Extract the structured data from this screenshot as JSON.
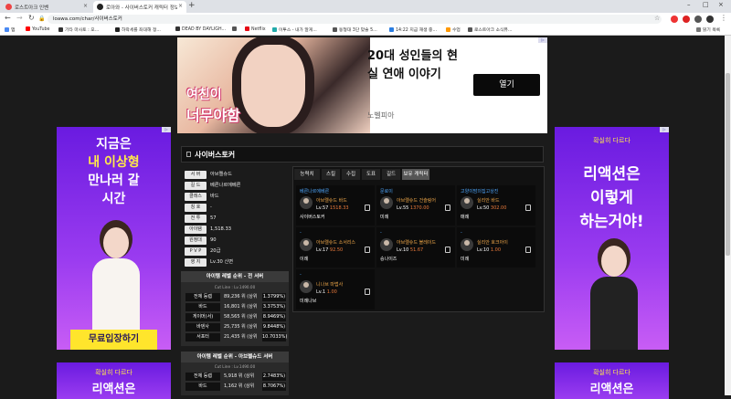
{
  "browser": {
    "tabs": [
      {
        "title": "로스트아크 인벤",
        "active": false
      },
      {
        "title": "로아와 - 사이버스토커 캐릭터 정보",
        "active": true
      }
    ],
    "url": "loawa.com/char/사이버스토커",
    "bookmarks": [
      "앱",
      "YouTube",
      "기타 마사토 : 오...",
      "하락세를 좌대해 정...",
      "DEAD BY DAYLIGH...",
      "",
      "Netflix",
      "이투스 - 내가 알게...",
      "동형대 3단 맞술 5...",
      "14:22 지금 재생 중...",
      "수업",
      "로스트아크 소식뷰...",
      "읽기 목록"
    ]
  },
  "top_ad": {
    "image_title_1": "여친이",
    "image_title_2": "너무야함",
    "headline": "20대 성인들의 현실 연애 이야기",
    "button": "열기",
    "brand": "노벨피아"
  },
  "left_ad": {
    "line1": "지금은",
    "line2": "내 이상형",
    "line3": "만나러 갈",
    "line4": "시간",
    "cta": "무료입장하기",
    "bottom_tag": "확실히 다르다",
    "bottom_text": "리액션은"
  },
  "right_ad": {
    "tag": "확실히 다르다",
    "line1": "리액션은",
    "line2": "이렇게",
    "line3": "하는거야!",
    "bottom_tag": "확실히 다르다",
    "bottom_text": "리액션은"
  },
  "character": {
    "name": "사이버스토커",
    "info": [
      {
        "label": "서 버",
        "value": "아브렐슈드"
      },
      {
        "label": "길 드",
        "value": "베른나르에베른"
      },
      {
        "label": "클래스",
        "value": "바드"
      },
      {
        "label": "칭 호",
        "value": "-"
      },
      {
        "label": "전 투",
        "value": "57"
      },
      {
        "label": "아이템",
        "value": "1,518.33"
      },
      {
        "label": "원정대",
        "value": "90"
      },
      {
        "label": "P V P",
        "value": "20급"
      },
      {
        "label": "영 지",
        "value": "Lv.30 신면"
      }
    ]
  },
  "ranking_all": {
    "title": "아이템 레벨 순위 - 전 서버",
    "cutline": "Cut Line : Lv.1490.00",
    "rows": [
      {
        "label": "전체 등렙",
        "rank": "89,236 위 (상위",
        "pct": "1.3799%)"
      },
      {
        "label": "바드",
        "rank": "16,801 위 (상위",
        "pct": "3.3753%)"
      },
      {
        "label": "게이머(서)",
        "rank": "58,565 위 (상위",
        "pct": "8.9469%)"
      },
      {
        "label": "바덴사",
        "rank": "25,735 위 (상위",
        "pct": "9.8448%)"
      },
      {
        "label": "서포터",
        "rank": "21,435 위 (상위",
        "pct": "10.7033%)"
      }
    ]
  },
  "ranking_server": {
    "title": "아이템 레벨 순위 - 아브렐슈드 서버",
    "cutline": "Cut Line : Lv.1490.00",
    "rows": [
      {
        "label": "전체 등렙",
        "rank": "5,918 위 (상위",
        "pct": "2.7483%)"
      },
      {
        "label": "바드",
        "rank": "1,162 위 (상위",
        "pct": "8.7067%)"
      }
    ]
  },
  "tabs": [
    "능력치",
    "스킬",
    "수집",
    "도표",
    "길드",
    "보유 캐릭터"
  ],
  "chars": [
    {
      "server": "베른나르에베른",
      "cls": "아브렐슈드 바드",
      "lv": "Lv.57",
      "il": "1518.33",
      "name": "사이버스토커"
    },
    {
      "server": "문로이",
      "cls": "아브렐슈드 건슬링어",
      "lv": "Lv.55",
      "il": "1370.00",
      "name": "미례"
    },
    {
      "server": "고양이맘의집고상진",
      "cls": "실리안 바드",
      "lv": "Lv.50",
      "il": "302.00",
      "name": "매례"
    },
    {
      "server": "-",
      "cls": "아브렐슈드 소서리스",
      "lv": "Lv.17",
      "il": "92.50",
      "name": "이례"
    },
    {
      "server": "-",
      "cls": "아브렐슈드 블레이드",
      "lv": "Lv.10",
      "il": "51.67",
      "name": "승나이즈"
    },
    {
      "server": "-",
      "cls": "실리안 호크아이",
      "lv": "Lv.10",
      "il": "1.00",
      "name": "미례"
    },
    {
      "server": "-",
      "cls": "니나브 마법사",
      "lv": "Lv.1",
      "il": "1.00",
      "name": "미례나브"
    }
  ]
}
